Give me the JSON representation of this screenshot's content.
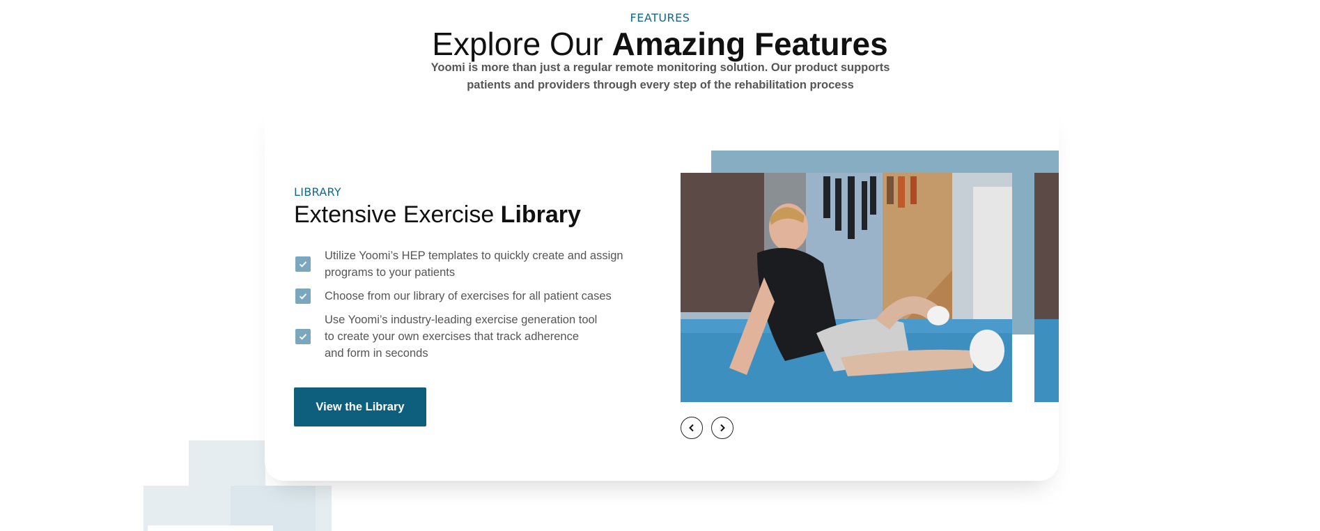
{
  "header": {
    "eyebrow": "FEATURES",
    "title_regular": "Explore Our ",
    "title_bold": "Amazing Features",
    "subtitle": "Yoomi is more than just a regular remote monitoring solution. Our product supports patients and providers through every step of the rehabilitation process"
  },
  "library": {
    "eyebrow": "LIBRARY",
    "title_regular": "Extensive Exercise ",
    "title_bold": "Library",
    "items": [
      {
        "text": "Utilize Yoomi’s HEP templates to quickly create and assign\nprograms to your patients"
      },
      {
        "text": "Choose from our library of exercises for all patient cases"
      },
      {
        "text": "Use Yoomi’s industry-leading exercise generation tool\nto create your own exercises that track adherence\nand form in seconds"
      }
    ],
    "cta_label": "View the Library"
  },
  "carousel": {
    "prev_icon": "chevron-left-icon",
    "next_icon": "chevron-right-icon"
  },
  "colors": {
    "accent": "#0e6a8a",
    "button": "#0d5f7d",
    "check": "#7aa7bd",
    "carousel_accent": "#86adc2",
    "deco": "#e5edf1"
  }
}
